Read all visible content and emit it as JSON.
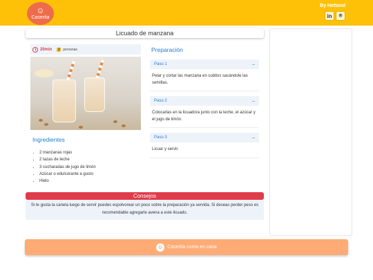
{
  "header": {
    "logo_text": "Caserita",
    "by_text": "By Hettand",
    "social": [
      {
        "icon": "linkedin-icon",
        "glyph": "in"
      },
      {
        "icon": "github-icon",
        "glyph": "⌾"
      }
    ]
  },
  "recipe": {
    "title": "Licuado de manzana",
    "time": "20min",
    "people_count": "2",
    "people_label": "personas"
  },
  "ingredients": {
    "title": "Ingredientes",
    "items": [
      "2 manzanas rojas",
      "2 tazas de leche",
      "3 cucharadas de jugo de limón",
      "Azúcar o edulcorante a gusto",
      "Hielo"
    ]
  },
  "preparation": {
    "title": "Preparación",
    "steps": [
      {
        "label": "Paso 1",
        "text": "Pelar y cortar las manzana en cubitos sacándole las semillas."
      },
      {
        "label": "Paso 2",
        "text": "Colocarlas en la licuadora junto con la leche, el azúcar y el jugo de limón."
      },
      {
        "label": "Paso 3",
        "text": "Licuar y servir."
      }
    ],
    "collapse_glyph": "–"
  },
  "tips": {
    "title": "Consejos",
    "text": "Si te gusta la canela luego de servir puedes espolvorear un poco sobre la preparación ya servida. Si deseas perder peso es recomendable agregarle avena a este licuado."
  },
  "footer": {
    "text": "Caserita como en casa"
  },
  "colors": {
    "header_bg": "#ffc107",
    "accent_blue": "#1e7bd0",
    "tips_red": "#e03b4a",
    "footer_bg": "#ffab76"
  }
}
